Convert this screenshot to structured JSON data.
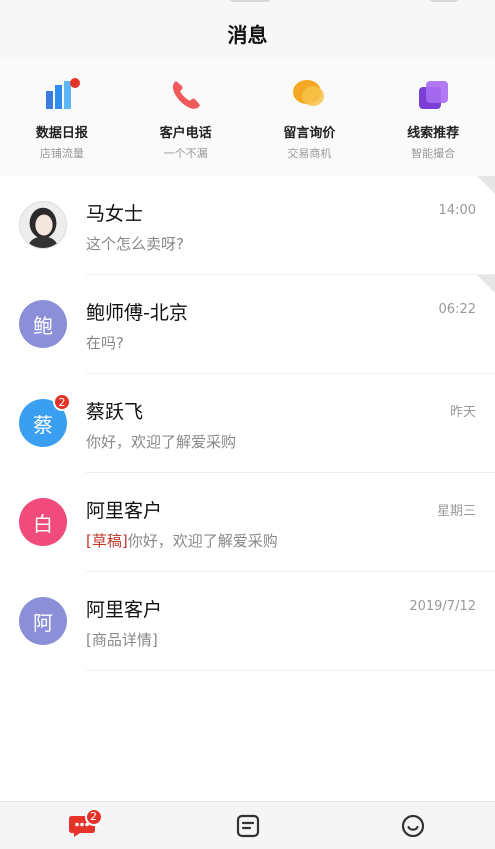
{
  "header": {
    "title": "消息"
  },
  "quick_actions": [
    {
      "label": "数据日报",
      "sub": "店铺流量",
      "icon": "bar-chart-icon"
    },
    {
      "label": "客户电话",
      "sub": "一个不漏",
      "icon": "phone-icon"
    },
    {
      "label": "留言询价",
      "sub": "交易商机",
      "icon": "chat-bubble-icon"
    },
    {
      "label": "线索推荐",
      "sub": "智能撮合",
      "icon": "layers-icon"
    }
  ],
  "conversations": [
    {
      "name": "马女士",
      "message": "这个怎么卖呀?",
      "time": "14:00",
      "avatar_text": "",
      "avatar_color": "#e9e9e9",
      "badge": ""
    },
    {
      "name": "鲍师傅-北京",
      "message": "在吗?",
      "time": "06:22",
      "avatar_text": "鲍",
      "avatar_color": "#8a8fd8",
      "badge": ""
    },
    {
      "name": "蔡跃飞",
      "message": "你好，欢迎了解爱采购",
      "time": "昨天",
      "avatar_text": "蔡",
      "avatar_color": "#3a9ff0",
      "badge": "2"
    },
    {
      "name": "阿里客户",
      "draft_tag": "[草稿]",
      "message": "你好，欢迎了解爱采购",
      "time": "星期三",
      "avatar_text": "白",
      "avatar_color": "#f04b7a",
      "badge": ""
    },
    {
      "name": "阿里客户",
      "message": "[商品详情]",
      "time": "2019/7/12",
      "avatar_text": "阿",
      "avatar_color": "#8a8fd8",
      "badge": ""
    }
  ],
  "tabbar": {
    "messages_badge": "2",
    "colors": {
      "active": "#e6332a",
      "inactive": "#333333"
    }
  }
}
